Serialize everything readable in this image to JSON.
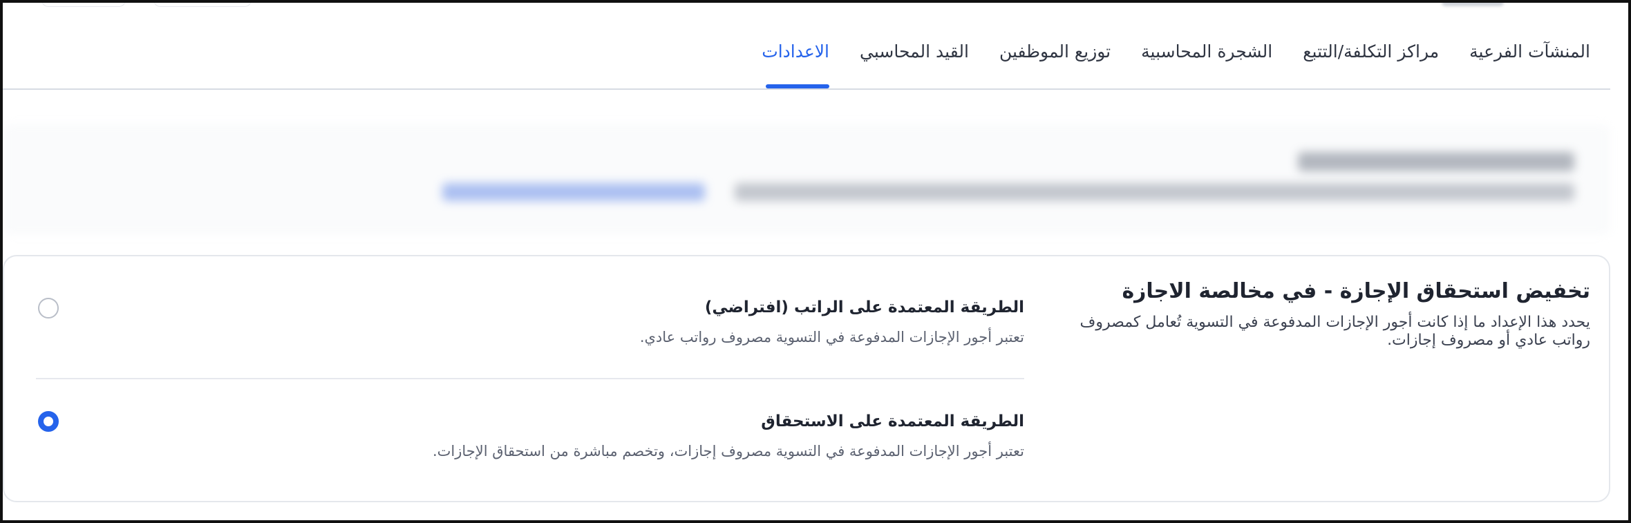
{
  "tabs": [
    {
      "label": "المنشآت الفرعية"
    },
    {
      "label": "مراكز التكلفة/التتبع"
    },
    {
      "label": "الشجرة المحاسبية"
    },
    {
      "label": "توزيع الموظفين"
    },
    {
      "label": "القيد المحاسبي"
    },
    {
      "label": "الاعدادات"
    }
  ],
  "active_tab": "الاعدادات",
  "accent_color": "#2563eb",
  "setting": {
    "title": "تخفيض استحقاق الإجازة - في مخالصة الاجازة",
    "description": "يحدد هذا الإعداد ما إذا كانت أجور الإجازات المدفوعة في التسوية تُعامل كمصروف رواتب عادي أو مصروف إجازات."
  },
  "options": [
    {
      "title": "الطريقة المعتمدة على الراتب (افتراضي)",
      "description": "تعتبر أجور الإجازات المدفوعة في التسوية مصروف رواتب عادي.",
      "selected": false
    },
    {
      "title": "الطريقة المعتمدة على الاستحقاق",
      "description": "تعتبر أجور الإجازات المدفوعة في التسوية مصروف إجازات، وتخصم مباشرة من استحقاق الإجازات.",
      "selected": true
    }
  ]
}
